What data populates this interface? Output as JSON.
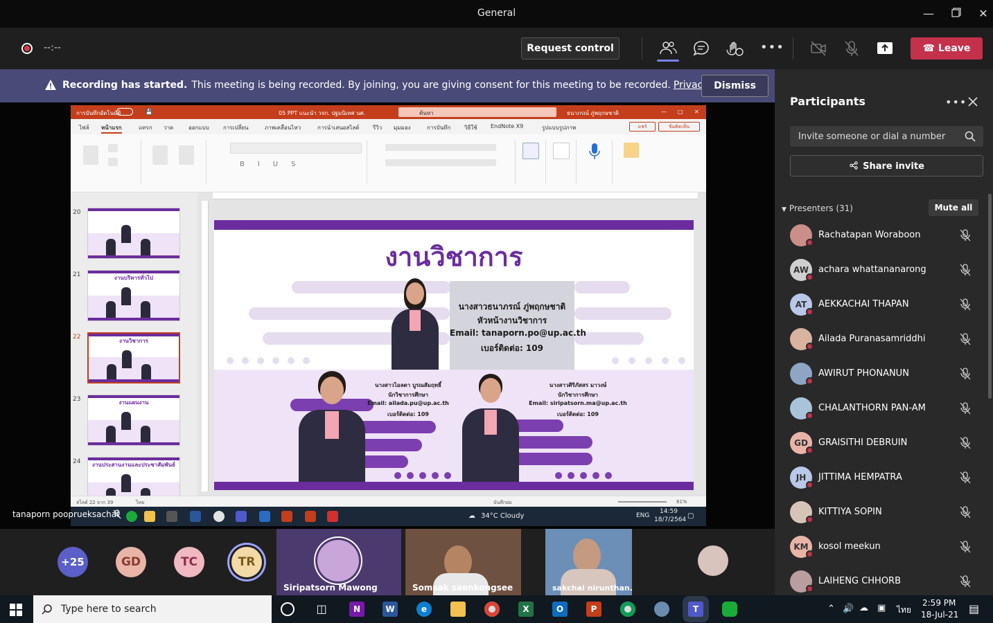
{
  "window": {
    "title": "General"
  },
  "toolbar": {
    "timer": "--:--",
    "request_control": "Request control",
    "leave": "Leave"
  },
  "banner": {
    "bold": "Recording has started.",
    "text": "This meeting is being recorded. By joining, you are giving consent for this meeting to be recorded.",
    "link": "Privacy policy",
    "dismiss": "Dismiss"
  },
  "shared": {
    "presenter": "tanaporn pooprueksachat",
    "ppt": {
      "filename": "05 PPT แนะนำ วจก. ปฐมนิเทศ นศ.",
      "search": "ค้นหา",
      "user": "ธนาภรณ์ ภู่พฤกษชาติ",
      "autosave": "การบันทึกอัตโนมัติ",
      "share": "แชร์",
      "comments": "ข้อคิดเห็น",
      "tabs": [
        "ไฟล์",
        "หน้าแรก",
        "แทรก",
        "วาด",
        "ออกแบบ",
        "การเปลี่ยน",
        "ภาพเคลื่อนไหว",
        "การนำเสนอสไลด์",
        "รีวิว",
        "มุมมอง",
        "การบันทึก",
        "วิธีใช้",
        "EndNote X9",
        "รูปแบบรูปภาพ"
      ],
      "thumb_numbers": [
        "20",
        "21",
        "22",
        "23",
        "24"
      ],
      "thumb_titles": [
        "",
        "งานบริหารทั่วไป",
        "งานวิชาการ",
        "งานแผนงาน",
        "งานประสานงานและประชาสัมพันธ์"
      ],
      "status_left": "สไลด์ 22 จาก 39",
      "status_lang": "ไทย",
      "status_notes": "บันทึกย่อ",
      "zoom": "81%"
    },
    "slide": {
      "heading": "งานวิชาการ",
      "head_name": "นางสาวธนาภรณ์ ภู่พฤกษชาติ",
      "head_role": "หัวหน้างานวิชาการ",
      "head_email": "Email: tanaporn.po@up.ac.th",
      "head_phone": "เบอร์ติดต่อ:   109",
      "p1_name": "นางสาวไอลดา บูรณสัมฤทธิ์",
      "p1_role": "นักวิชาการศึกษา",
      "p1_email": "Email: ailada.pu@up.ac.th",
      "p1_phone": "เบอร์ติดต่อ:   109",
      "p2_name": "นางสาวศิริภัสสร มาวงษ์",
      "p2_role": "นักวิชาการศึกษา",
      "p2_email": "Email: siripatsorn.ma@up.ac.th",
      "p2_phone": "เบอร์ติดต่อ:   109"
    },
    "mini_taskbar": {
      "weather": "34°C  Cloudy",
      "lang": "ENG",
      "time": "14:59",
      "date": "18/7/2564"
    }
  },
  "gallery": {
    "overflow": "+25",
    "avatars": [
      {
        "initials": "GD",
        "color": "#e8b4a8",
        "text": "#8a3b2c"
      },
      {
        "initials": "TC",
        "color": "#f0b8c0",
        "text": "#8c2e46"
      },
      {
        "initials": "TR",
        "color": "#f2d9a6",
        "text": "#7a5a18"
      }
    ],
    "tiles": [
      "Siripatsorn Mawong",
      "Somsak saenkongsee",
      "sakchai nirunthan..."
    ]
  },
  "panel": {
    "title": "Participants",
    "invite_placeholder": "Invite someone or dial a number",
    "share_invite": "Share invite",
    "presenters_label": "Presenters (31)",
    "mute_all": "Mute all",
    "people": [
      {
        "name": "Rachatapan Woraboon",
        "initials": "",
        "color": "#c98f88"
      },
      {
        "name": "achara whattananarong",
        "initials": "AW",
        "color": "#cfcfcf"
      },
      {
        "name": "AEKKACHAI THAPAN",
        "initials": "AT",
        "color": "#b9c8e8"
      },
      {
        "name": "Ailada Puranasamriddhi",
        "initials": "",
        "color": "#d8b3a0"
      },
      {
        "name": "AWIRUT PHONANUN",
        "initials": "",
        "color": "#8ea6c4"
      },
      {
        "name": "CHALANTHORN PAN-AM",
        "initials": "",
        "color": "#a9c3d9"
      },
      {
        "name": "GRAISITHI DEBRUIN",
        "initials": "GD",
        "color": "#e8b4a8"
      },
      {
        "name": "JITTIMA HEMPATRA",
        "initials": "JH",
        "color": "#b9c8e8"
      },
      {
        "name": "KITTIYA SOPIN",
        "initials": "",
        "color": "#d7c4b8"
      },
      {
        "name": "kosol meekun",
        "initials": "KM",
        "color": "#e8b4a8"
      },
      {
        "name": "LAIHENG CHHORB",
        "initials": "",
        "color": "#b89ea0"
      }
    ]
  },
  "taskbar": {
    "search_placeholder": "Type here to search",
    "lang": "ไทย",
    "time": "2:59 PM",
    "date": "18-Jul-21"
  }
}
